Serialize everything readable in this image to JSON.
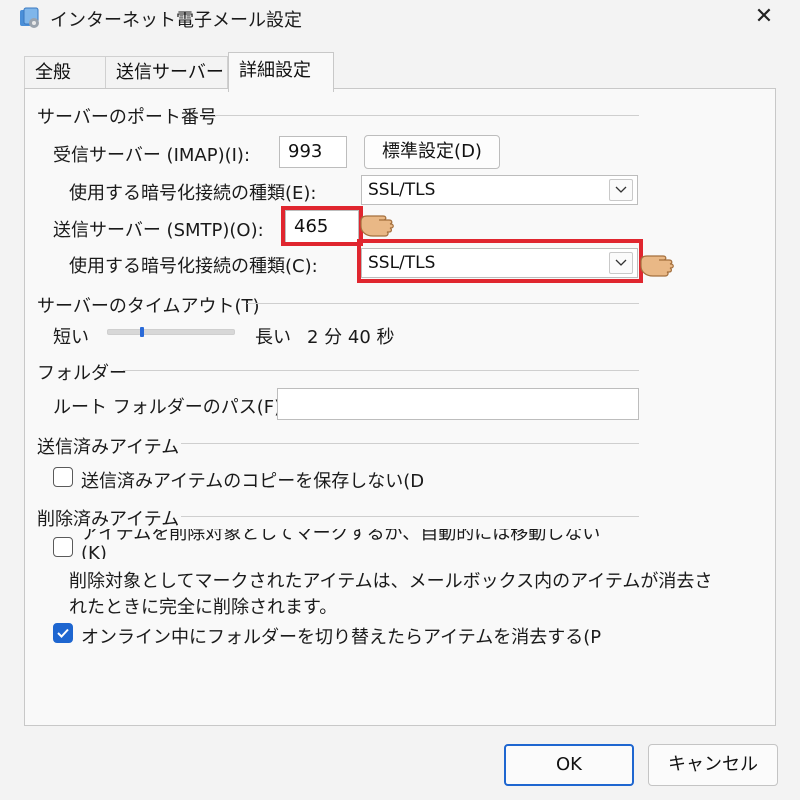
{
  "window": {
    "title": "インターネット電子メール設定"
  },
  "tabs": [
    {
      "label": "全般"
    },
    {
      "label": "送信サーバー"
    },
    {
      "label": "詳細設定"
    }
  ],
  "ports": {
    "group_label": "サーバーのポート番号",
    "incoming_label": "受信サーバー (IMAP)(I):",
    "incoming_value": "993",
    "default_button": "標準設定(D)",
    "incoming_enc_label": "使用する暗号化接続の種類(E):",
    "incoming_enc_value": "SSL/TLS",
    "outgoing_label": "送信サーバー (SMTP)(O):",
    "outgoing_value": "465",
    "outgoing_enc_label": "使用する暗号化接続の種類(C):",
    "outgoing_enc_value": "SSL/TLS"
  },
  "timeout": {
    "group_label": "サーバーのタイムアウト(T)",
    "short_label": "短い",
    "long_label": "長い",
    "value_label": "2 分 40 秒",
    "slider_fraction": 0.27
  },
  "folders": {
    "group_label": "フォルダー",
    "root_path_label": "ルート フォルダーのパス(F):",
    "root_path_value": ""
  },
  "sent": {
    "group_label": "送信済みアイテム",
    "no_copy_label": "送信済みアイテムのコピーを保存しない(D",
    "no_copy_checked": false
  },
  "deleted": {
    "group_label": "削除済みアイテム",
    "mark_label_line1": "アイテムを削除対象としてマークするが、自動的には移動しない",
    "mark_label_line2": "(K)",
    "mark_checked": false,
    "note_line1": "削除対象としてマークされたアイテムは、メールボックス内のアイテムが消去さ",
    "note_line2": "れたときに完全に削除されます。",
    "purge_label": "オンライン中にフォルダーを切り替えたらアイテムを消去する(P",
    "purge_checked": true
  },
  "footer": {
    "ok_label": "OK",
    "cancel_label": "キャンセル"
  },
  "colors": {
    "highlight": "#e0262f",
    "accent": "#1e66d0"
  },
  "icons": {
    "app": "mail-settings-icon",
    "close": "close-icon",
    "chevron": "chevron-down-icon",
    "check": "check-icon",
    "pointer": "pointing-hand-icon"
  }
}
